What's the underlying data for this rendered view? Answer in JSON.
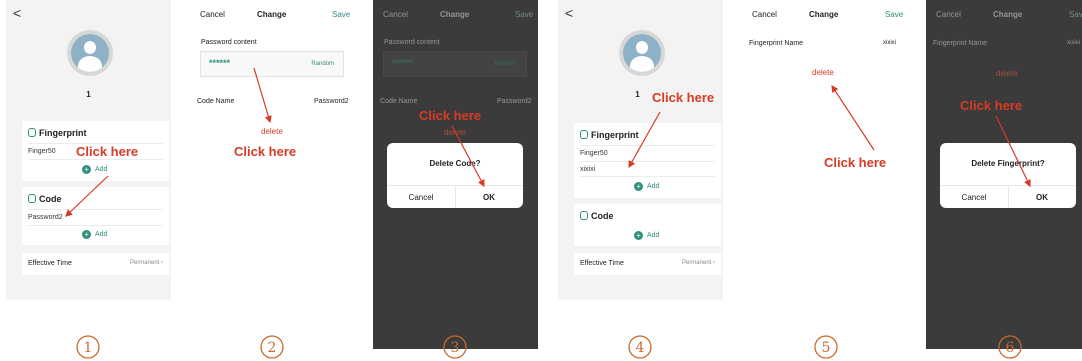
{
  "common": {
    "back": "<",
    "cancel": "Cancel",
    "change": "Change",
    "save": "Save",
    "add": "Add",
    "delete": "delete",
    "click_here": "Click here",
    "ok": "OK",
    "plus": "+",
    "user_name": "1",
    "fingerprint": "Fingerprint",
    "code": "Code",
    "effective_time": "Effective Time",
    "permanent": "Permanent"
  },
  "panel1": {
    "finger": "Finger50",
    "code_item": "Password2"
  },
  "panel2": {
    "password_content": "Password content",
    "password_mask": "******",
    "random": "Random",
    "code_name_label": "Code Name",
    "code_name_value": "Password2"
  },
  "panel3": {
    "dialog_title": "Delete Code?"
  },
  "panel4": {
    "finger": "Finger50",
    "finger2": "xixixi"
  },
  "panel5": {
    "fp_name_label": "Fingerprint Name",
    "fp_name_value": "xixixi"
  },
  "panel6": {
    "dialog_title": "Delete Fingerprint?"
  },
  "steps": [
    "1",
    "2",
    "3",
    "4",
    "5",
    "6"
  ],
  "colors": {
    "accent": "#2f8f7f",
    "annotation": "#d83a25",
    "overlay": "#3b3b3b",
    "step_number": "#c96a2c"
  }
}
